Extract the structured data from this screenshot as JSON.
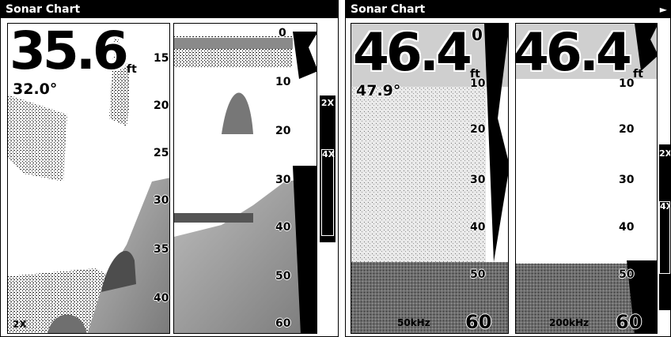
{
  "left": {
    "title": "Sonar Chart",
    "depth": "35.6",
    "unit": "ft",
    "temp": "32.0°",
    "scale_labels": [
      "15",
      "20",
      "25",
      "30",
      "35",
      "40"
    ],
    "scale_labels_zoom": [
      "0",
      "10",
      "20",
      "30",
      "40",
      "50",
      "60"
    ],
    "zoom_bar": [
      "2X",
      "4X"
    ],
    "zoom_label": "2X"
  },
  "right": {
    "title": "Sonar Chart",
    "depth_a": "46.4",
    "depth_b": "46.4",
    "unit": "ft",
    "temp": "47.9°",
    "scale_labels": [
      "0",
      "10",
      "20",
      "30",
      "40",
      "50"
    ],
    "bottom_depth_a": "60",
    "bottom_depth_b": "60",
    "freq_a": "50kHz",
    "freq_b": "200kHz",
    "zoom_bar": [
      "2X",
      "4X"
    ]
  },
  "colors": {
    "background": "#ffffff",
    "text": "#000000",
    "bottom": "#6a6a6a",
    "grey": "#9a9a9a"
  }
}
